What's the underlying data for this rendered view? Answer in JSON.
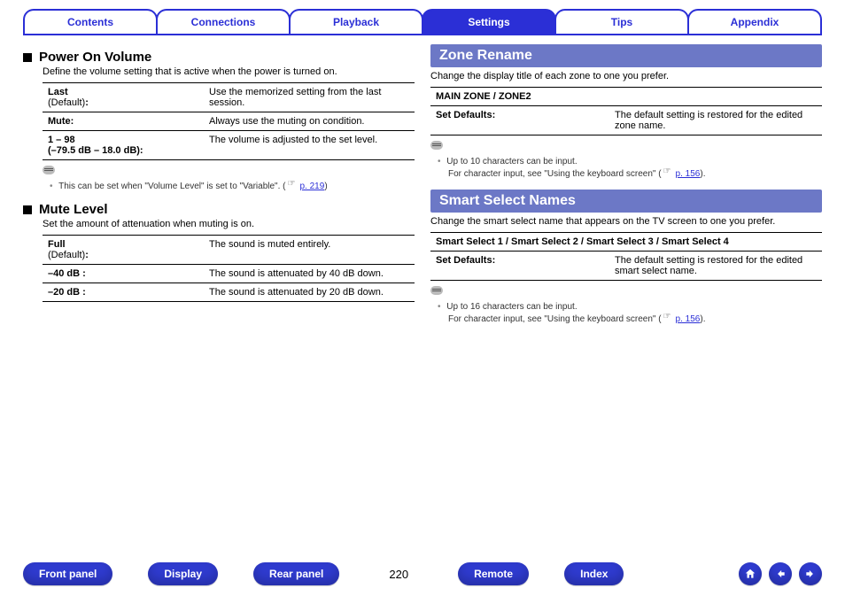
{
  "tabs": [
    {
      "label": "Contents",
      "active": false
    },
    {
      "label": "Connections",
      "active": false
    },
    {
      "label": "Playback",
      "active": false
    },
    {
      "label": "Settings",
      "active": true
    },
    {
      "label": "Tips",
      "active": false
    },
    {
      "label": "Appendix",
      "active": false
    }
  ],
  "left": {
    "powerOn": {
      "title": "Power On Volume",
      "lead": "Define the volume setting that is active when the power is turned on.",
      "rows": [
        {
          "keyMain": "Last",
          "keySub": "(Default)",
          "keyColon": ":",
          "val": "Use the memorized setting from the last session."
        },
        {
          "keyMain": "Mute:",
          "keySub": "",
          "keyColon": "",
          "val": "Always use the muting on condition."
        },
        {
          "keyMain": "1 – 98",
          "keySub": "(–79.5 dB – 18.0 dB):",
          "keyColon": "",
          "val": "The volume is adjusted to the set level.",
          "boldSub": true
        }
      ],
      "note": {
        "bullets": [
          "This can be set when \"Volume Level\" is set to \"Variable\".  ("
        ],
        "ref": "p. 219",
        "tail": ")"
      }
    },
    "muteLevel": {
      "title": "Mute Level",
      "lead": "Set the amount of attenuation when muting is on.",
      "rows": [
        {
          "keyMain": "Full",
          "keySub": "(Default)",
          "keyColon": ":",
          "val": "The sound is muted entirely."
        },
        {
          "keyMain": "–40 dB :",
          "keySub": "",
          "keyColon": "",
          "val": "The sound is attenuated by 40 dB down."
        },
        {
          "keyMain": "–20 dB :",
          "keySub": "",
          "keyColon": "",
          "val": "The sound is attenuated by 20 dB down."
        }
      ]
    }
  },
  "right": {
    "zoneRename": {
      "title": "Zone Rename",
      "lead": "Change the display title of each zone to one you prefer.",
      "header": "MAIN ZONE / ZONE2",
      "rows": [
        {
          "key": "Set Defaults:",
          "val": "The default setting is restored for the edited zone name."
        }
      ],
      "note": {
        "line1": "Up to 10 characters can be input.",
        "line2a": "For character input, see \"Using the keyboard screen\" (",
        "ref": "p. 156",
        "tail": ")."
      }
    },
    "smartSelect": {
      "title": "Smart Select Names",
      "lead": "Change the smart select name that appears on the TV screen to one you prefer.",
      "header": "Smart Select 1 / Smart Select 2 / Smart Select 3 / Smart Select 4",
      "rows": [
        {
          "key": "Set Defaults:",
          "val": "The default setting is restored for the edited smart select name."
        }
      ],
      "note": {
        "line1": "Up to 16 characters can be input.",
        "line2a": "For character input, see \"Using the keyboard screen\" (",
        "ref": "p. 156",
        "tail": ")."
      }
    }
  },
  "footer": {
    "links": [
      "Front panel",
      "Display",
      "Rear panel"
    ],
    "page": "220",
    "links2": [
      "Remote",
      "Index"
    ]
  }
}
